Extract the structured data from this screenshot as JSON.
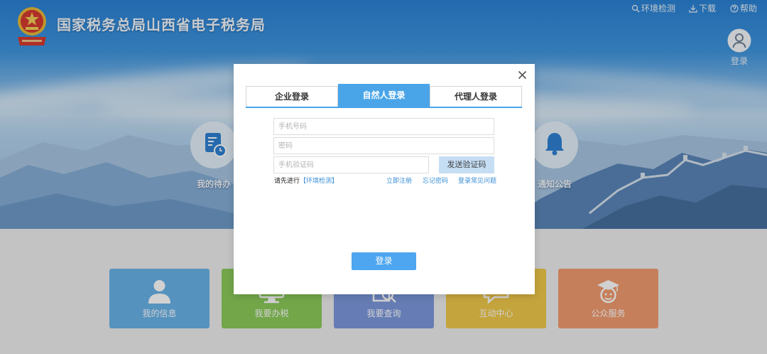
{
  "header": {
    "title": "国家税务总局山西省电子税务局",
    "logo_icon": "tax-emblem-logo",
    "links": [
      {
        "label": "环境检测",
        "icon": "env-check-icon"
      },
      {
        "label": "下载",
        "icon": "download-icon"
      },
      {
        "label": "帮助",
        "icon": "help-icon"
      }
    ],
    "user": {
      "label": "登录",
      "icon": "user-avatar-icon"
    }
  },
  "quick_entries": [
    {
      "label": "我的待办",
      "icon": "todo-document-icon"
    },
    {
      "label": "通知公告",
      "icon": "bell-icon"
    }
  ],
  "tiles": [
    {
      "label": "我的信息",
      "icon": "person-icon",
      "color": "#68b2e8"
    },
    {
      "label": "我要办税",
      "icon": "monitor-icon",
      "color": "#8ccb5a"
    },
    {
      "label": "我要查询",
      "icon": "search-document-icon",
      "color": "#7c98dc"
    },
    {
      "label": "互动中心",
      "icon": "chat-bubble-icon",
      "color": "#f0c84a"
    },
    {
      "label": "公众服务",
      "icon": "graduation-cap-icon",
      "color": "#f29b70"
    }
  ],
  "login_modal": {
    "close_icon": "close-icon",
    "tabs": [
      {
        "label": "企业登录",
        "active": false
      },
      {
        "label": "自然人登录",
        "active": true
      },
      {
        "label": "代理人登录",
        "active": false
      }
    ],
    "fields": {
      "phone": {
        "placeholder": "手机号码"
      },
      "password": {
        "placeholder": "密码"
      },
      "sms_code": {
        "placeholder": "手机验证码"
      }
    },
    "send_code_label": "发送验证码",
    "hint": {
      "prefix": "请先进行",
      "link": "【环境检测】"
    },
    "links": {
      "register": "立即注册",
      "forgot_password": "忘记密码",
      "faq": "登录常见问题"
    },
    "submit_label": "登录"
  },
  "colors": {
    "accent": "#4aa5e8",
    "link": "#3b8fd6",
    "send_button": "#c6def4",
    "submit_button": "#4da6ef"
  }
}
